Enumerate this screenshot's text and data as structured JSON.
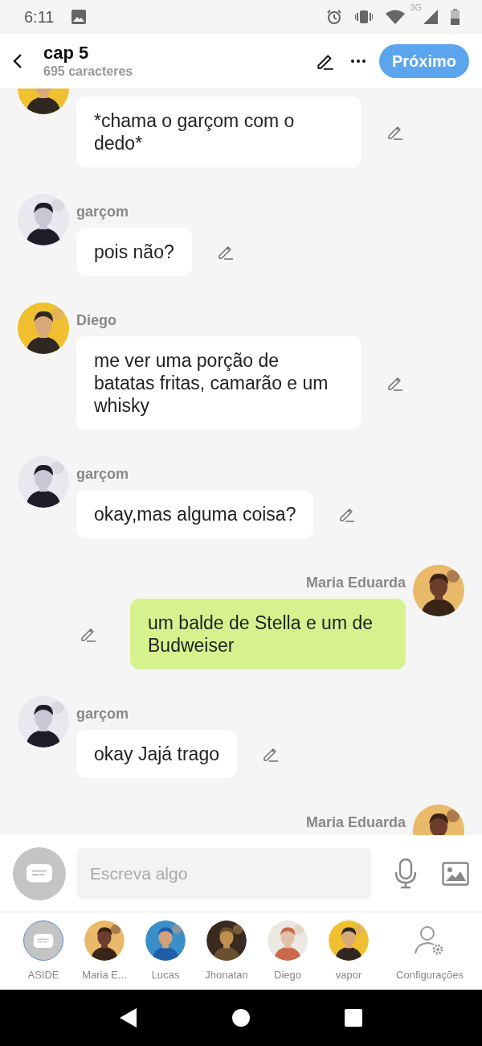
{
  "status_bar": {
    "time": "6:11",
    "network": "3G"
  },
  "header": {
    "title": "cap 5",
    "subtitle": "695 caracteres",
    "next_button": "Próximo"
  },
  "messages": [
    {
      "kind": "other",
      "text": "*chama o garçom com o dedo*"
    },
    {
      "kind": "other",
      "name": "garçom",
      "text": "pois não?"
    },
    {
      "kind": "other",
      "name": "Diego",
      "text": "me ver uma porção de batatas fritas, camarão e um whisky"
    },
    {
      "kind": "other",
      "name": "garçom",
      "text": "okay,mas alguma coisa?"
    },
    {
      "kind": "self",
      "name": "Maria Eduarda",
      "text": "um balde de Stella e um de Budweiser"
    },
    {
      "kind": "other",
      "name": "garçom",
      "text": "okay Jajá trago"
    },
    {
      "kind": "self",
      "name": "Maria Eduarda"
    }
  ],
  "composer": {
    "placeholder": "Escreva algo"
  },
  "characters": [
    {
      "kind": "aside",
      "name": "ASIDE",
      "selected": true
    },
    {
      "kind": "character",
      "name": "Maria E...",
      "selected": false
    },
    {
      "kind": "character",
      "name": "Lucas",
      "selected": false
    },
    {
      "kind": "character",
      "name": "Jhonatan",
      "selected": false
    },
    {
      "kind": "character",
      "name": "Diego",
      "selected": false
    },
    {
      "kind": "character",
      "name": "vapor",
      "selected": false
    }
  ],
  "settings_button": {
    "label": "Configurações"
  }
}
